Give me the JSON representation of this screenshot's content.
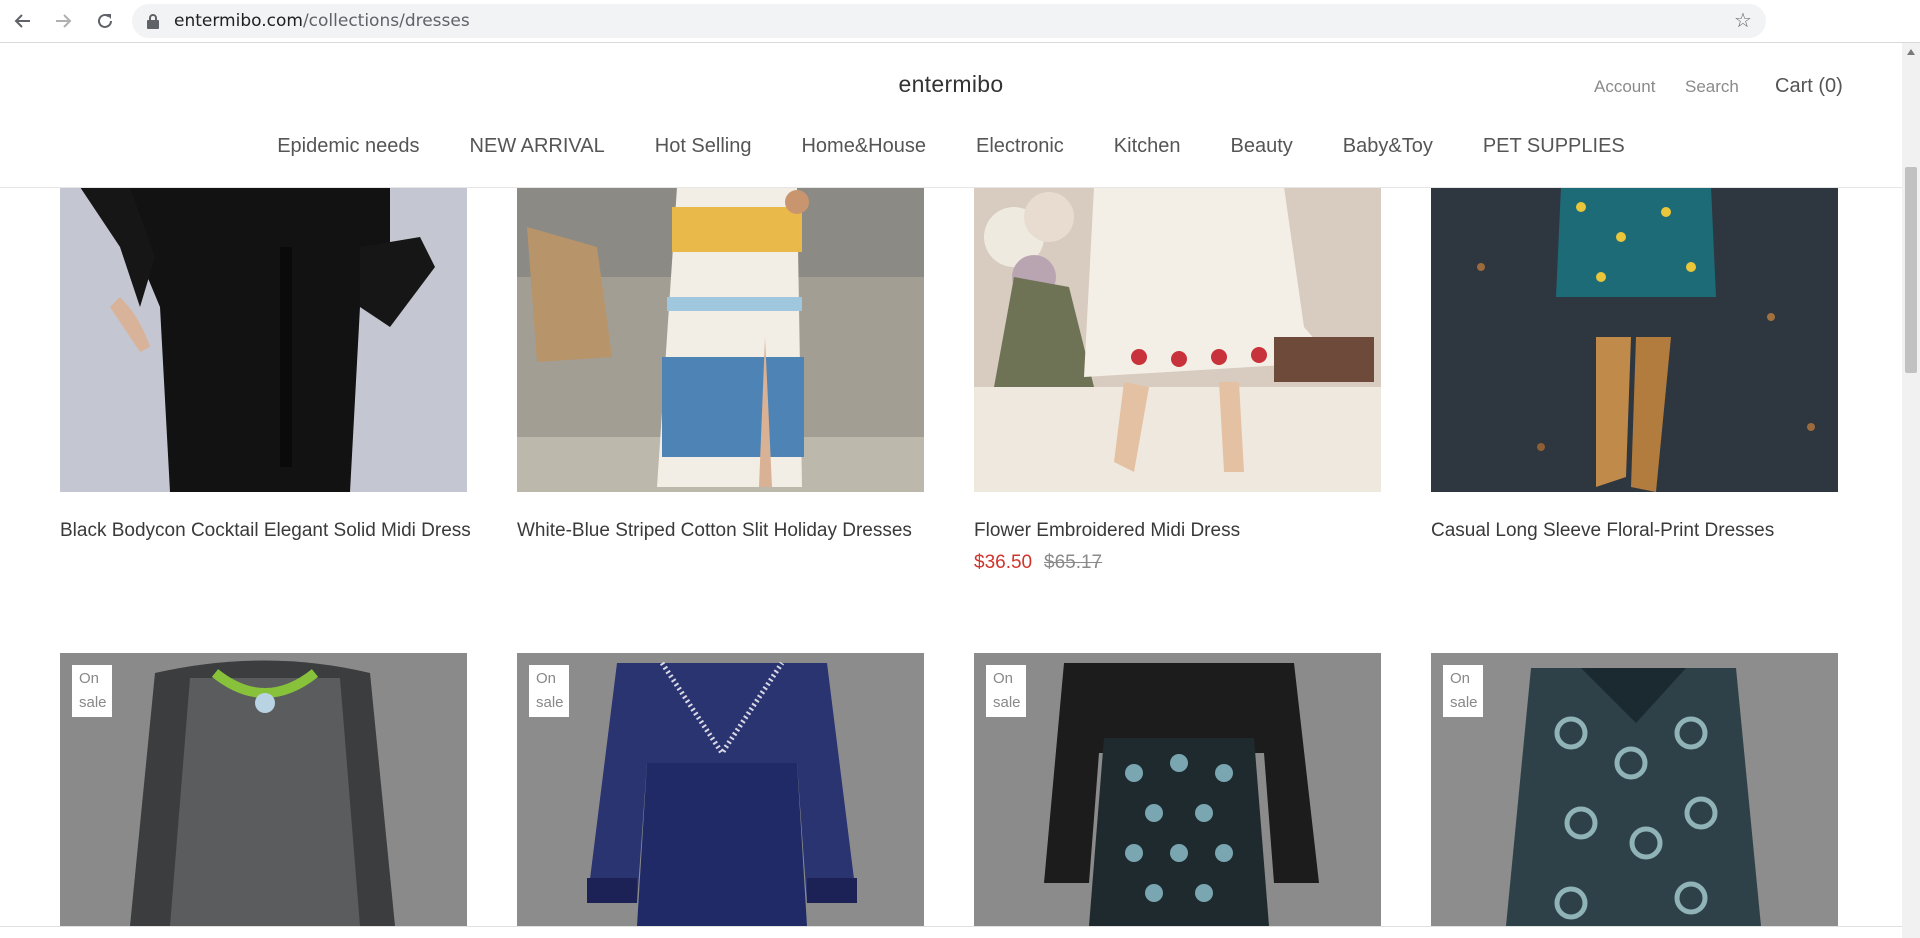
{
  "browser": {
    "url_domain": "entermibo.com",
    "url_path": "/collections/dresses"
  },
  "header": {
    "logo": "entermibo",
    "account": "Account",
    "search": "Search",
    "cart": "Cart (0)"
  },
  "nav": [
    "Epidemic needs",
    "NEW ARRIVAL",
    "Hot Selling",
    "Home&House",
    "Electronic",
    "Kitchen",
    "Beauty",
    "Baby&Toy",
    "PET SUPPLIES"
  ],
  "products_row1": [
    {
      "title": "Black Bodycon Cocktail Elegant Solid Midi Dress"
    },
    {
      "title": "White-Blue Striped Cotton Slit Holiday Dresses"
    },
    {
      "title": "Flower Embroidered Midi Dress",
      "price": "$36.50",
      "compare_price": "$65.17"
    },
    {
      "title": "Casual Long Sleeve Floral-Print Dresses"
    }
  ],
  "badge_line1": "On",
  "badge_line2": "sale"
}
